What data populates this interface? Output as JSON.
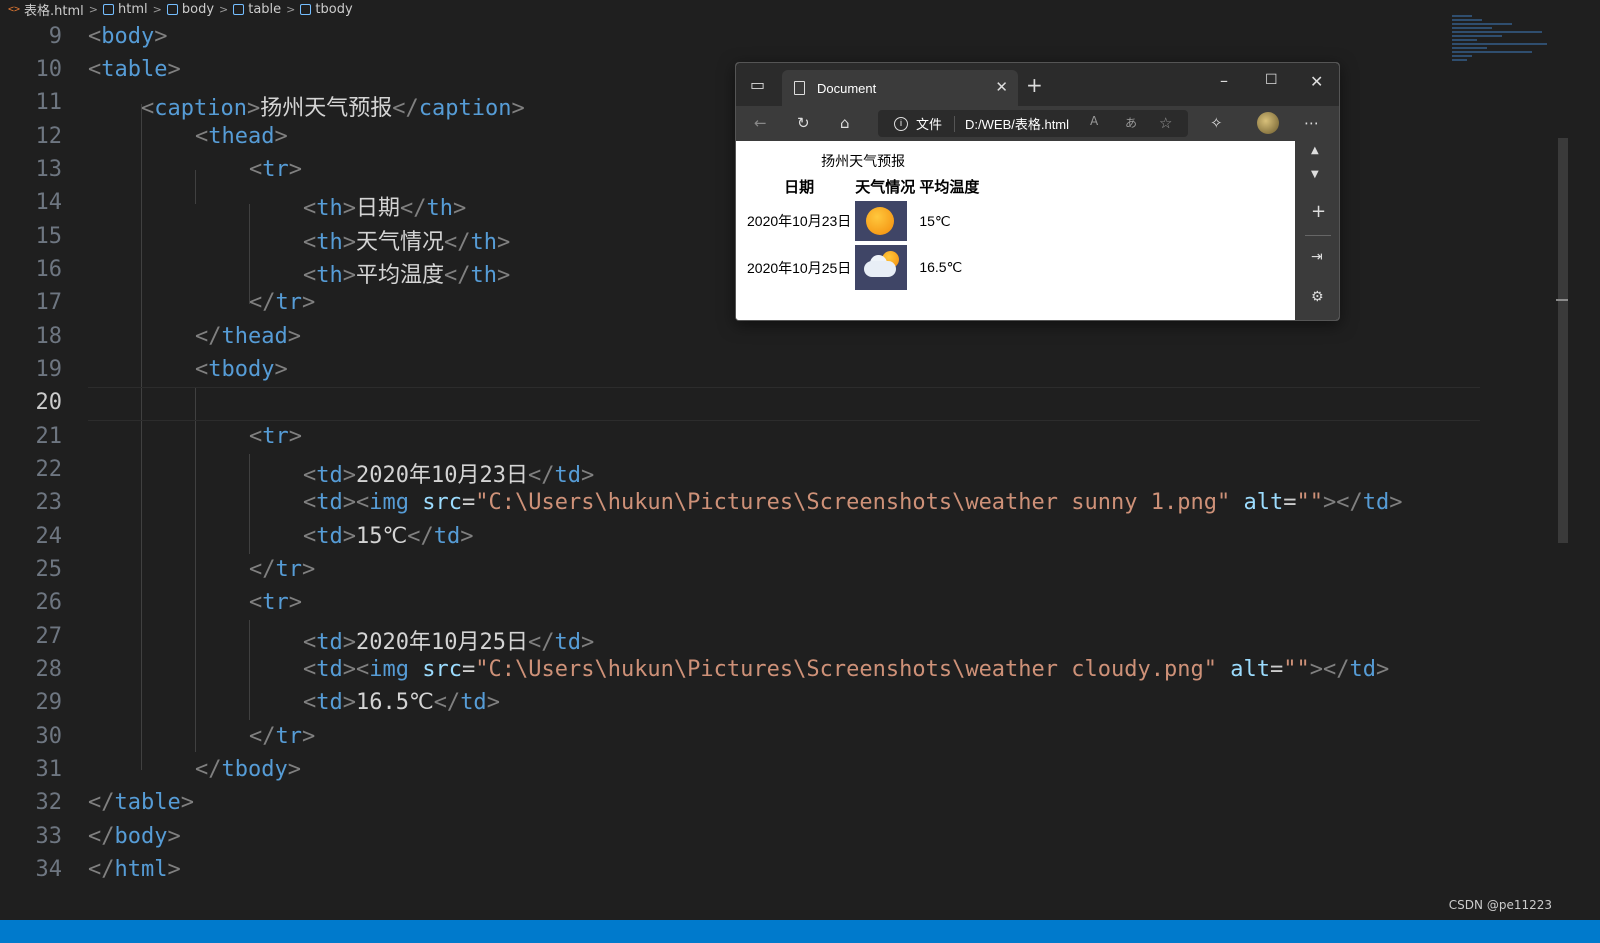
{
  "breadcrumb": {
    "items": [
      "表格.html",
      "html",
      "body",
      "table",
      "tbody"
    ]
  },
  "editor": {
    "lines": [
      {
        "no": "9"
      },
      {
        "no": "10"
      },
      {
        "no": "11"
      },
      {
        "no": "12"
      },
      {
        "no": "13"
      },
      {
        "no": "14"
      },
      {
        "no": "15"
      },
      {
        "no": "16"
      },
      {
        "no": "17"
      },
      {
        "no": "18"
      },
      {
        "no": "19"
      },
      {
        "no": "20"
      },
      {
        "no": "21"
      },
      {
        "no": "22"
      },
      {
        "no": "23"
      },
      {
        "no": "24"
      },
      {
        "no": "25"
      },
      {
        "no": "26"
      },
      {
        "no": "27"
      },
      {
        "no": "28"
      },
      {
        "no": "29"
      },
      {
        "no": "30"
      },
      {
        "no": "31"
      },
      {
        "no": "32"
      },
      {
        "no": "33"
      },
      {
        "no": "34"
      }
    ],
    "active_line": "20",
    "tags": {
      "body": "body",
      "table": "table",
      "caption": "caption",
      "thead": "thead",
      "tr": "tr",
      "th": "th",
      "tbody": "tbody",
      "td": "td",
      "img": "img",
      "html": "html"
    },
    "text": {
      "caption": "扬州天气预报",
      "th1": "日期",
      "th2": "天气情况",
      "th3": "平均温度",
      "date1": "2020年10月23日",
      "src1": "\"C:\\Users\\hukun\\Pictures\\Screenshots\\weather sunny 1.png\"",
      "temp1": "15℃",
      "date2": "2020年10月25日",
      "src2": "\"C:\\Users\\hukun\\Pictures\\Screenshots\\weather cloudy.png\"",
      "temp2": "16.5℃",
      "attr_src": "src",
      "attr_alt": "alt",
      "alt_val": "\"\""
    }
  },
  "browser": {
    "tab_title": "Document",
    "address_label": "文件",
    "address_url": "D:/WEB/表格.html",
    "page": {
      "caption": "扬州天气预报",
      "headers": [
        "日期",
        "天气情况",
        "平均温度"
      ],
      "rows": [
        {
          "date": "2020年10月23日",
          "weather_icon": "sunny-icon",
          "temp": "15℃"
        },
        {
          "date": "2020年10月25日",
          "weather_icon": "cloudy-icon",
          "temp": "16.5℃"
        }
      ]
    }
  },
  "watermark": "CSDN @pe11223",
  "colors": {
    "editor_bg": "#1f1f1f",
    "tag": "#569cd6",
    "attribute": "#9cdcfe",
    "string": "#ce9178",
    "statusbar": "#007acc"
  }
}
